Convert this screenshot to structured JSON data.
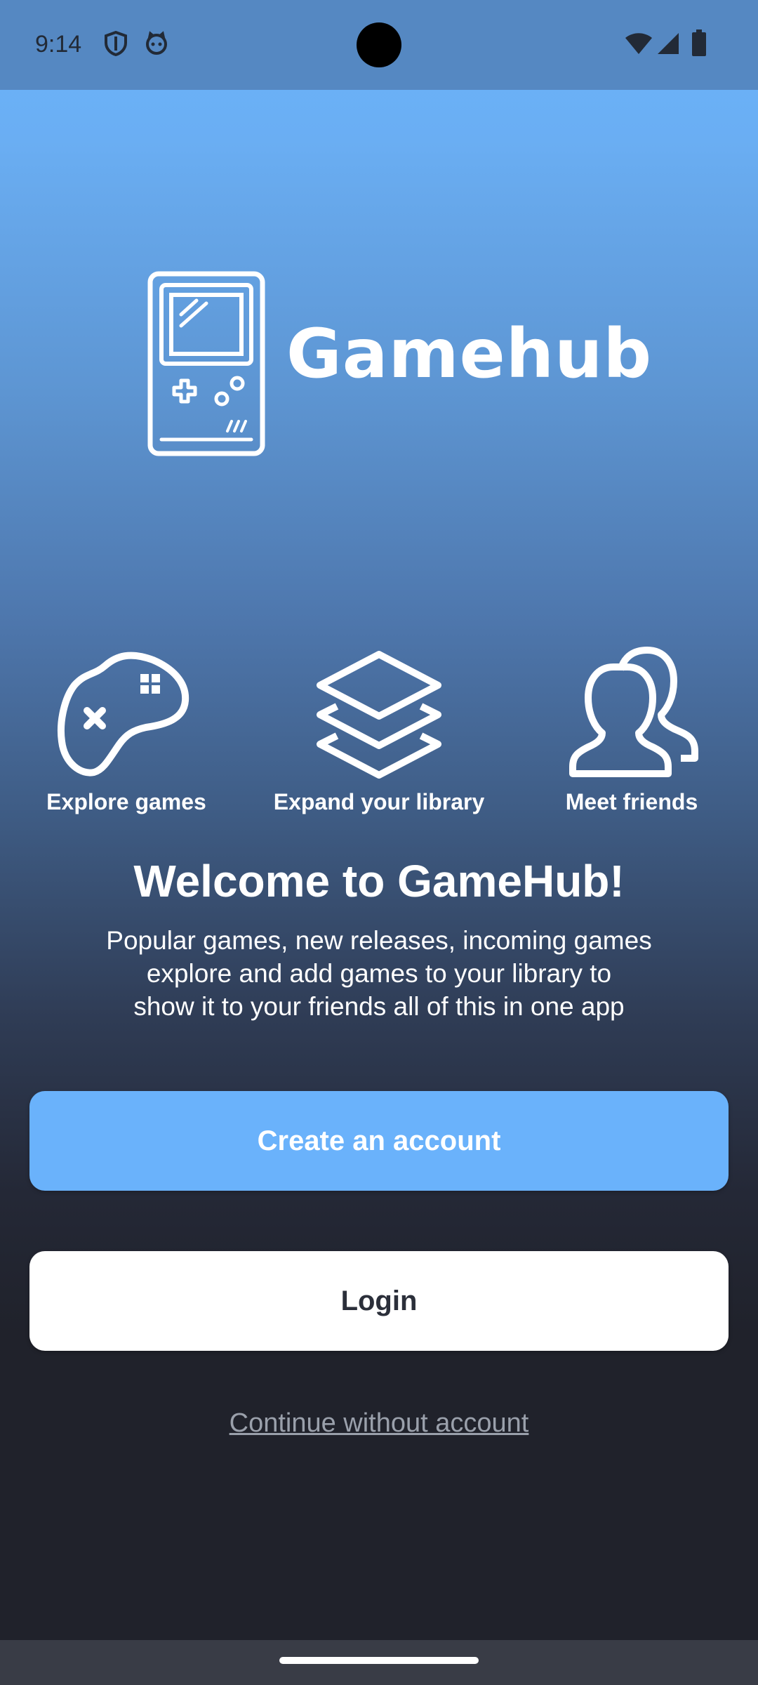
{
  "status_bar": {
    "time": "9:14",
    "left_icons": [
      "shield-icon",
      "cat-face-icon"
    ],
    "right_icons": [
      "wifi-icon",
      "cellular-signal-icon",
      "battery-icon"
    ]
  },
  "brand": {
    "name": "Gamehub",
    "logo_icon": "handheld-console-icon",
    "color": "#ffffff"
  },
  "features": [
    {
      "label": "Explore games",
      "icon": "gamepad-icon"
    },
    {
      "label": "Expand your library",
      "icon": "layers-icon"
    },
    {
      "label": "Meet friends",
      "icon": "users-icon"
    }
  ],
  "welcome": {
    "title": "Welcome to GameHub!",
    "lines": [
      "Popular games, new releases, incoming games",
      "explore and add games to your library to",
      "show it to your friends all of this in one app"
    ]
  },
  "actions": {
    "create_account": "Create an account",
    "login": "Login",
    "continue_without_account": "Continue without account"
  },
  "colors": {
    "accent": "#6ab2fb",
    "background_dark": "#20222b",
    "status_bar": "#5588c2",
    "link": "#9aa0ab"
  }
}
